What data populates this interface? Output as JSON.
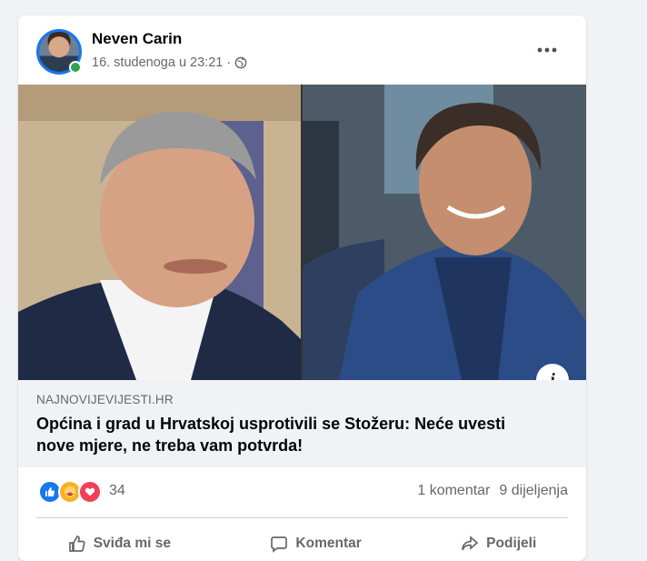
{
  "post": {
    "author": "Neven Carin",
    "date": "16. studenoga u 23:21",
    "separator": "·",
    "privacy_icon": "globe-icon",
    "more_icon": "more-horizontal-icon"
  },
  "link": {
    "domain": "NAJNOVIJEVIJESTI.HR",
    "title": "Općina i grad u Hrvatskoj usprotivili se Stožeru: Neće uvesti nove mjere, ne treba vam potvrda!",
    "info_label": "i"
  },
  "stats": {
    "reactions": [
      "like-icon",
      "care-icon",
      "love-icon"
    ],
    "reaction_count": "34",
    "comments": "1 komentar",
    "shares": "9 dijeljenja"
  },
  "actions": {
    "like": "Sviđa mi se",
    "comment": "Komentar",
    "share": "Podijeli"
  },
  "colors": {
    "accent": "#1877f2",
    "online": "#31a24c",
    "love": "#f33e58",
    "care": "#f7b125"
  }
}
